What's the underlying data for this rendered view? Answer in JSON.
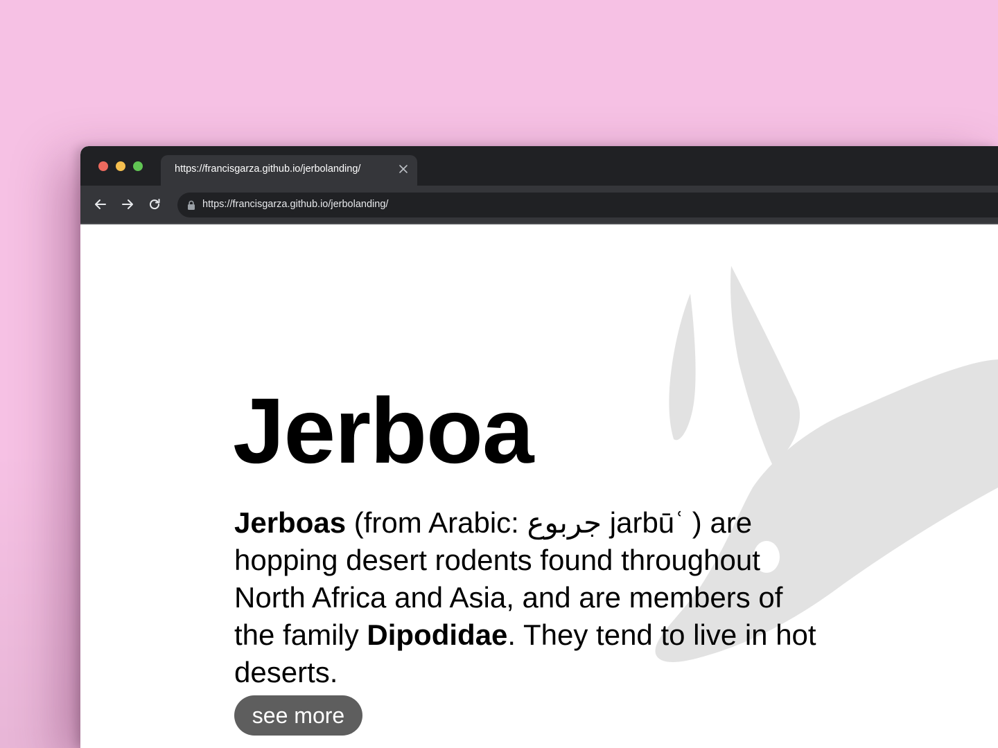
{
  "browser": {
    "tab_title": "https://francisgarza.github.io/jerbolanding/",
    "address_url": "https://francisgarza.github.io/jerbolanding/"
  },
  "page": {
    "title": "Jerboa",
    "description": {
      "term": "Jerboas",
      "intro": " (from Arabic: ",
      "arabic": "جربوع",
      "transliteration": " jarbūʿ ) are hopping desert rodents found throughout North Africa and Asia, and are members of the family ",
      "family": "Dipodidae",
      "ending": ". They tend to live in hot deserts."
    },
    "button_label": "see more"
  },
  "colors": {
    "page_background": "#f6c1e4",
    "chrome_dark": "#202124",
    "chrome_toolbar": "#35363a",
    "button_background": "#5e5e5e",
    "illustration_gray": "#e2e2e2"
  },
  "icons": {
    "close": "close-icon",
    "back": "arrow-left-icon",
    "forward": "arrow-right-icon",
    "reload": "reload-icon",
    "lock": "lock-icon"
  }
}
